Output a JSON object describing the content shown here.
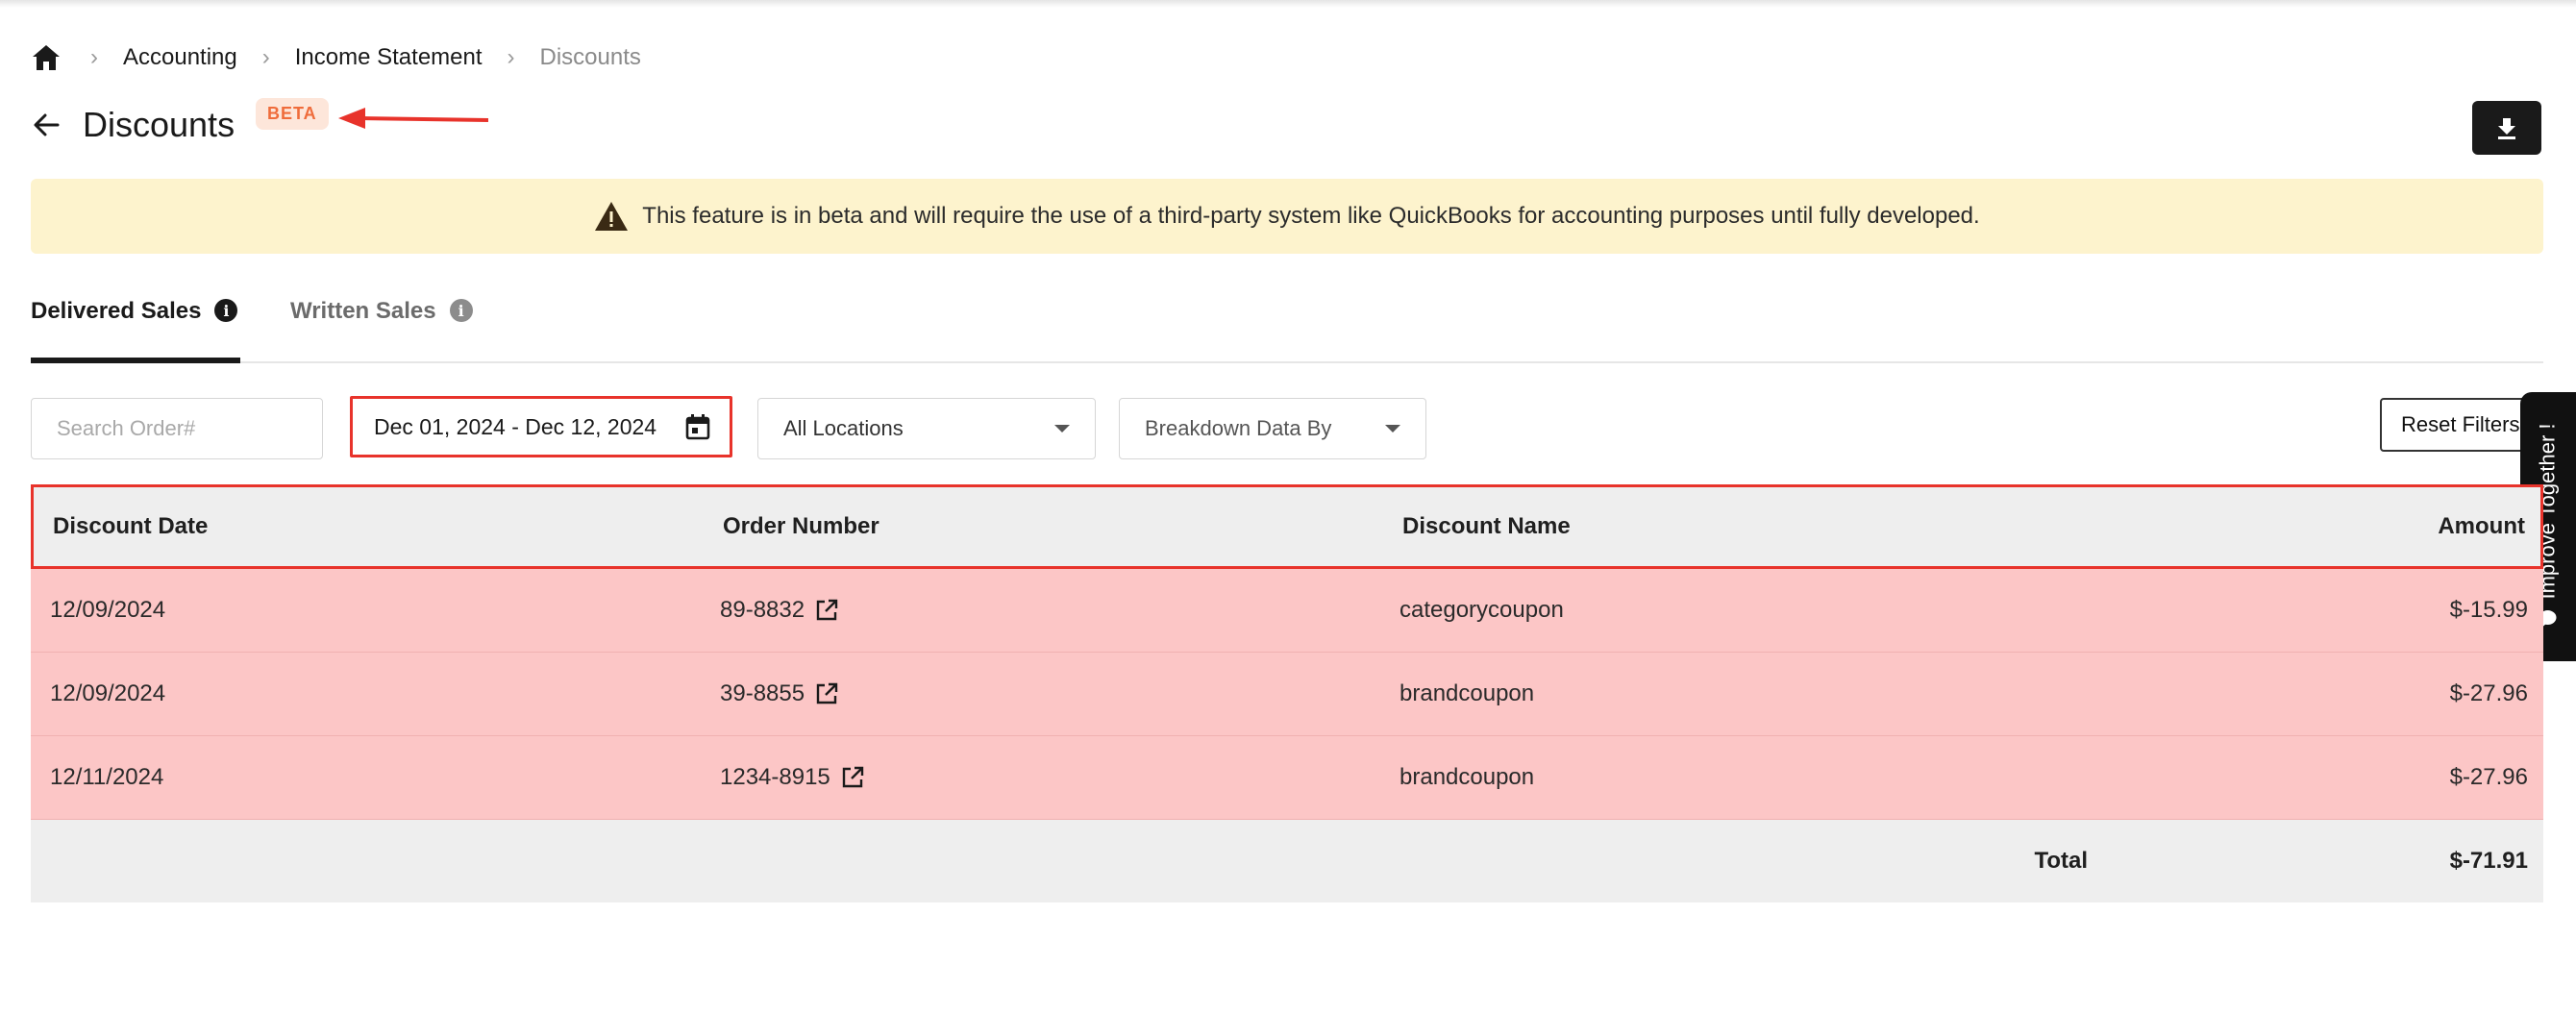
{
  "breadcrumb": {
    "items": [
      "Accounting",
      "Income Statement"
    ],
    "current": "Discounts"
  },
  "page": {
    "title": "Discounts",
    "badge": "BETA"
  },
  "banner": {
    "text": "This feature is in beta and will require the use of a third-party system like QuickBooks for accounting purposes until fully developed."
  },
  "tabs": [
    {
      "label": "Delivered Sales",
      "active": true
    },
    {
      "label": "Written Sales",
      "active": false
    }
  ],
  "filters": {
    "search_placeholder": "Search Order#",
    "date_range": "Dec 01, 2024 - Dec 12, 2024",
    "location": "All Locations",
    "breakdown": "Breakdown Data By",
    "reset_label": "Reset Filters"
  },
  "feedback": {
    "label": "Improve Together !"
  },
  "table": {
    "columns": [
      "Discount Date",
      "Order Number",
      "Discount Name",
      "Amount"
    ],
    "rows": [
      {
        "date": "12/09/2024",
        "order": "89-8832",
        "name": "categorycoupon",
        "amount": "$-15.99"
      },
      {
        "date": "12/09/2024",
        "order": "39-8855",
        "name": "brandcoupon",
        "amount": "$-27.96"
      },
      {
        "date": "12/11/2024",
        "order": "1234-8915",
        "name": "brandcoupon",
        "amount": "$-27.96"
      }
    ],
    "total_label": "Total",
    "total_value": "$-71.91"
  },
  "colors": {
    "highlight_row": "#fcc6c6",
    "annotation": "#e8332b",
    "banner": "#fdf3cd",
    "badge_text": "#ef6c3b"
  }
}
